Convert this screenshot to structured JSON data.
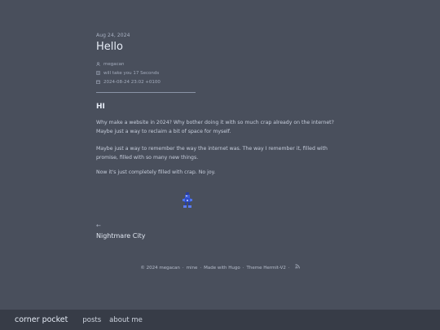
{
  "post": {
    "date": "Aug 24, 2024",
    "title": "Hello",
    "meta": {
      "author": "megacan",
      "reading_time": "will take you 17 Seconds",
      "timestamp": "2024-08-24 23:02 +0100"
    },
    "heading": "HI",
    "paragraphs": [
      "Why make a website in 2024? Why bother doing it with so much crap already on the internet? Maybe just a way to reclaim a bit of space for myself.",
      "Maybe just a way to remember the way the internet was. The way I remember it, filled with promise, filled with so many new things.",
      "Now it's just completely filled with crap. No joy."
    ]
  },
  "prev_post": {
    "arrow": "←",
    "title": "Nightmare City"
  },
  "footer": {
    "copyright": "© 2024 megacan",
    "mine": "mine",
    "made_with": "Made with Hugo",
    "theme": "Theme Hermit-V2",
    "separator": "·"
  },
  "nav": {
    "brand": "corner pocket",
    "links": [
      "posts",
      "about me"
    ]
  },
  "icons": {
    "author": "user-icon",
    "reading_time": "file-icon",
    "timestamp": "calendar-icon",
    "rss": "rss-icon",
    "figure": "pixel-character-icon"
  },
  "colors": {
    "background": "#494f5c",
    "nav_background": "#373c47"
  }
}
